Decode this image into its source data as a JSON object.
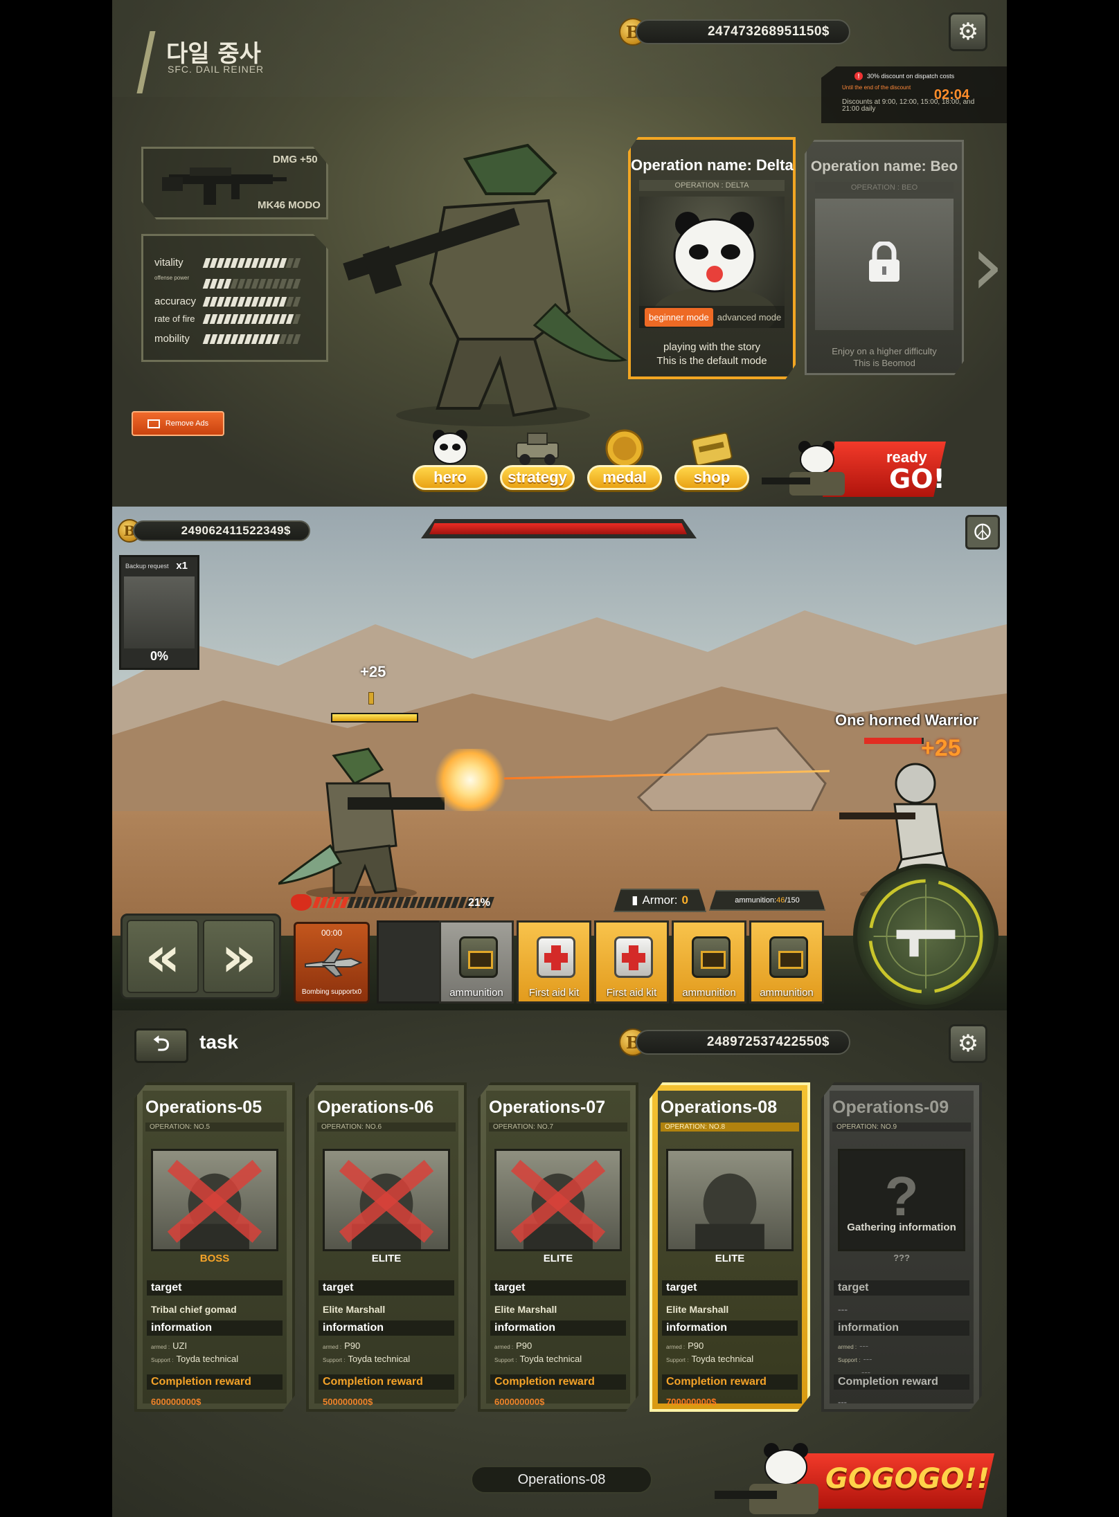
{
  "lobby": {
    "name_ko": "다일 중사",
    "name_en": "SFC. DAIL REINER",
    "weapon": {
      "dmg": "DMG +50",
      "name": "MK46 MODO"
    },
    "stats": [
      {
        "label": "vitality",
        "level": 0.85
      },
      {
        "label": "offense power",
        "level": 0.3
      },
      {
        "label": "accuracy",
        "level": 0.85
      },
      {
        "label": "rate of fire",
        "level": 0.95
      },
      {
        "label": "mobility",
        "level": 0.8
      }
    ],
    "remove_ads": "Remove Ads",
    "money": "247473268951150$",
    "discount": {
      "title": "30% discount on dispatch costs",
      "until": "Until the end of the discount",
      "timer": "02:04",
      "note": "Discounts at 9:00, 12:00, 15:00, 18:00, and 21:00 daily"
    },
    "operations": [
      {
        "title": "Operation name: Delta",
        "sub": "OPERATION : DELTA",
        "mode_on": "beginner mode",
        "mode_off": "advanced mode",
        "desc1": "playing with the story",
        "desc2": "This is the default mode"
      },
      {
        "title": "Operation name: Beo",
        "sub": "OPERATION : BEO",
        "desc1": "Enjoy on a higher difficulty",
        "desc2": "This is Beomod"
      }
    ],
    "menu": {
      "hero": "hero",
      "strategy": "strategy",
      "medal": "medal",
      "shop": "shop"
    },
    "ready": {
      "line1": "ready",
      "line2": "GO!"
    }
  },
  "battle": {
    "money": "249062411522349$",
    "backup": {
      "title": "Backup request",
      "count": "x1",
      "pct": "0%"
    },
    "float_plus": "+25",
    "enemy_name": "One horned Warrior",
    "enemy_plus": "+25",
    "rage_pct": "21%",
    "rage_level": 0.21,
    "armor_label": "Armor:",
    "armor_value": "0",
    "ammo_label": "ammunition:",
    "ammo_current": "46",
    "ammo_max": "/150",
    "bomb": {
      "time": "00:00",
      "label": "Bombing supportx0"
    },
    "items": [
      {
        "label": "ammunition",
        "kind": "ammo",
        "style": "grey"
      },
      {
        "label": "First aid kit",
        "kind": "aid",
        "style": "gold"
      },
      {
        "label": "First aid kit",
        "kind": "aid",
        "style": "gold"
      },
      {
        "label": "ammunition",
        "kind": "ammo",
        "style": "gold"
      },
      {
        "label": "ammunition",
        "kind": "ammo",
        "style": "gold"
      }
    ]
  },
  "task": {
    "title": "task",
    "money": "248972537422550$",
    "missions": [
      {
        "title": "Operations-05",
        "sub": "OPERATION: NO.5",
        "badge": "BOSS",
        "target_h": "target",
        "target": "Tribal chief gomad",
        "info_h": "information",
        "armed": "UZI",
        "support": "Toyda technical",
        "reward_h": "Completion reward",
        "reward": "600000000$",
        "state": "done"
      },
      {
        "title": "Operations-06",
        "sub": "OPERATION: NO.6",
        "badge": "ELITE",
        "target_h": "target",
        "target": "Elite Marshall",
        "info_h": "information",
        "armed": "P90",
        "support": "Toyda technical",
        "reward_h": "Completion reward",
        "reward": "500000000$",
        "state": "done"
      },
      {
        "title": "Operations-07",
        "sub": "OPERATION: NO.7",
        "badge": "ELITE",
        "target_h": "target",
        "target": "Elite Marshall",
        "info_h": "information",
        "armed": "P90",
        "support": "Toyda technical",
        "reward_h": "Completion reward",
        "reward": "600000000$",
        "state": "done"
      },
      {
        "title": "Operations-08",
        "sub": "OPERATION: NO.8",
        "badge": "ELITE",
        "target_h": "target",
        "target": "Elite Marshall",
        "info_h": "information",
        "armed": "P90",
        "support": "Toyda technical",
        "reward_h": "Completion reward",
        "reward": "700000000$",
        "state": "active"
      },
      {
        "title": "Operations-09",
        "sub": "OPERATION: NO.9",
        "badge": "???",
        "gathering": "Gathering information",
        "target_h": "target",
        "target": "---",
        "info_h": "information",
        "armed": "---",
        "support": "---",
        "extra1": "---",
        "extra2": "---",
        "reward_h": "Completion reward",
        "reward": "---",
        "state": "locked"
      }
    ],
    "armed_tag": "armed :",
    "support_tag": "Support :",
    "current": "Operations-08",
    "go": "GOGOGO!!"
  }
}
